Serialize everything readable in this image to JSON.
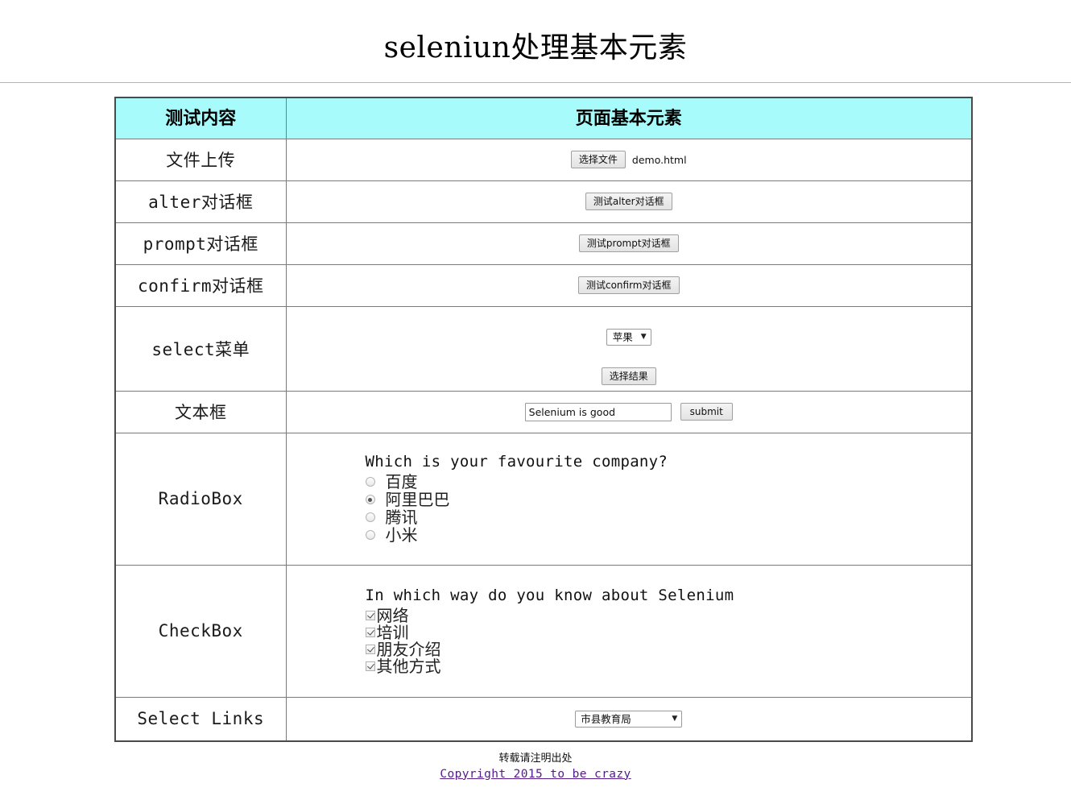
{
  "page": {
    "title": "seleniun处理基本元素"
  },
  "table": {
    "headers": {
      "label": "测试内容",
      "content": "页面基本元素"
    },
    "rows": [
      {
        "label": "文件上传"
      },
      {
        "label": "alter对话框"
      },
      {
        "label": "prompt对话框"
      },
      {
        "label": "confirm对话框"
      },
      {
        "label": "select菜单"
      },
      {
        "label": "文本框"
      },
      {
        "label": "RadioBox"
      },
      {
        "label": "CheckBox"
      },
      {
        "label": "Select Links"
      }
    ]
  },
  "file_upload": {
    "button_label": "选择文件",
    "file_name": "demo.html"
  },
  "dialogs": {
    "alert_button": "测试alter对话框",
    "prompt_button": "测试prompt对话框",
    "confirm_button": "测试confirm对话框"
  },
  "select_menu": {
    "selected": "苹果",
    "caret": "▼",
    "result_button": "选择结果"
  },
  "text_box": {
    "value": "Selenium is good",
    "placeholder": "",
    "submit_label": "submit"
  },
  "radio_box": {
    "question": "Which is your favourite company?",
    "options": [
      {
        "label": "百度",
        "checked": false
      },
      {
        "label": "阿里巴巴",
        "checked": true
      },
      {
        "label": "腾讯",
        "checked": false
      },
      {
        "label": "小米",
        "checked": false
      }
    ]
  },
  "check_box": {
    "question": "In which way do you know about Selenium",
    "options": [
      {
        "label": "网络",
        "checked": true
      },
      {
        "label": "培训",
        "checked": true
      },
      {
        "label": "朋友介绍",
        "checked": true
      },
      {
        "label": "其他方式",
        "checked": true
      }
    ]
  },
  "select_links": {
    "selected": "市县教育局",
    "caret": "▼"
  },
  "footer": {
    "note": "转载请注明出处",
    "link": "Copyright 2015 to be crazy"
  },
  "colors": {
    "header_bg": "#a8fbfb",
    "table_border": "#4a4a4a",
    "cell_border": "#7a7a7a",
    "link": "#551a8b"
  }
}
